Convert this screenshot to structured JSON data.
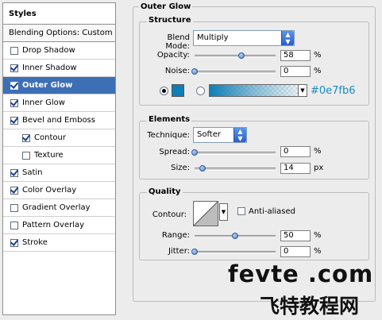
{
  "styles_panel": {
    "header": "Styles",
    "blending_options": "Blending Options: Custom",
    "items": [
      {
        "label": "Drop Shadow",
        "checked": false,
        "sub": false,
        "selected": false
      },
      {
        "label": "Inner Shadow",
        "checked": true,
        "sub": false,
        "selected": false
      },
      {
        "label": "Outer Glow",
        "checked": true,
        "sub": false,
        "selected": true
      },
      {
        "label": "Inner Glow",
        "checked": true,
        "sub": false,
        "selected": false
      },
      {
        "label": "Bevel and Emboss",
        "checked": true,
        "sub": false,
        "selected": false
      },
      {
        "label": "Contour",
        "checked": true,
        "sub": true,
        "selected": false
      },
      {
        "label": "Texture",
        "checked": false,
        "sub": true,
        "selected": false
      },
      {
        "label": "Satin",
        "checked": true,
        "sub": false,
        "selected": false
      },
      {
        "label": "Color Overlay",
        "checked": true,
        "sub": false,
        "selected": false
      },
      {
        "label": "Gradient Overlay",
        "checked": false,
        "sub": false,
        "selected": false
      },
      {
        "label": "Pattern Overlay",
        "checked": false,
        "sub": false,
        "selected": false
      },
      {
        "label": "Stroke",
        "checked": true,
        "sub": false,
        "selected": false
      }
    ]
  },
  "outer_glow": {
    "title": "Outer Glow",
    "structure": {
      "legend": "Structure",
      "blend_mode_label": "Blend Mode:",
      "blend_mode_value": "Multiply",
      "opacity_label": "Opacity:",
      "opacity_value": "58",
      "opacity_percent": 58,
      "noise_label": "Noise:",
      "noise_value": "0",
      "noise_percent": 0,
      "percent_unit": "%",
      "glow_color": "#0e7fb6",
      "color_hex_label": "#0e7fb6"
    },
    "elements": {
      "legend": "Elements",
      "technique_label": "Technique:",
      "technique_value": "Softer",
      "spread_label": "Spread:",
      "spread_value": "0",
      "spread_percent": 0,
      "size_label": "Size:",
      "size_value": "14",
      "size_fraction": 0.1,
      "size_unit": "px",
      "percent_unit": "%"
    },
    "quality": {
      "legend": "Quality",
      "contour_label": "Contour:",
      "anti_aliased_label": "Anti-aliased",
      "anti_aliased_checked": false,
      "range_label": "Range:",
      "range_value": "50",
      "range_percent": 50,
      "jitter_label": "Jitter:",
      "jitter_value": "0",
      "jitter_percent": 0,
      "percent_unit": "%"
    }
  },
  "watermark": {
    "line1": "fevte .com",
    "line2": "飞特教程网"
  }
}
